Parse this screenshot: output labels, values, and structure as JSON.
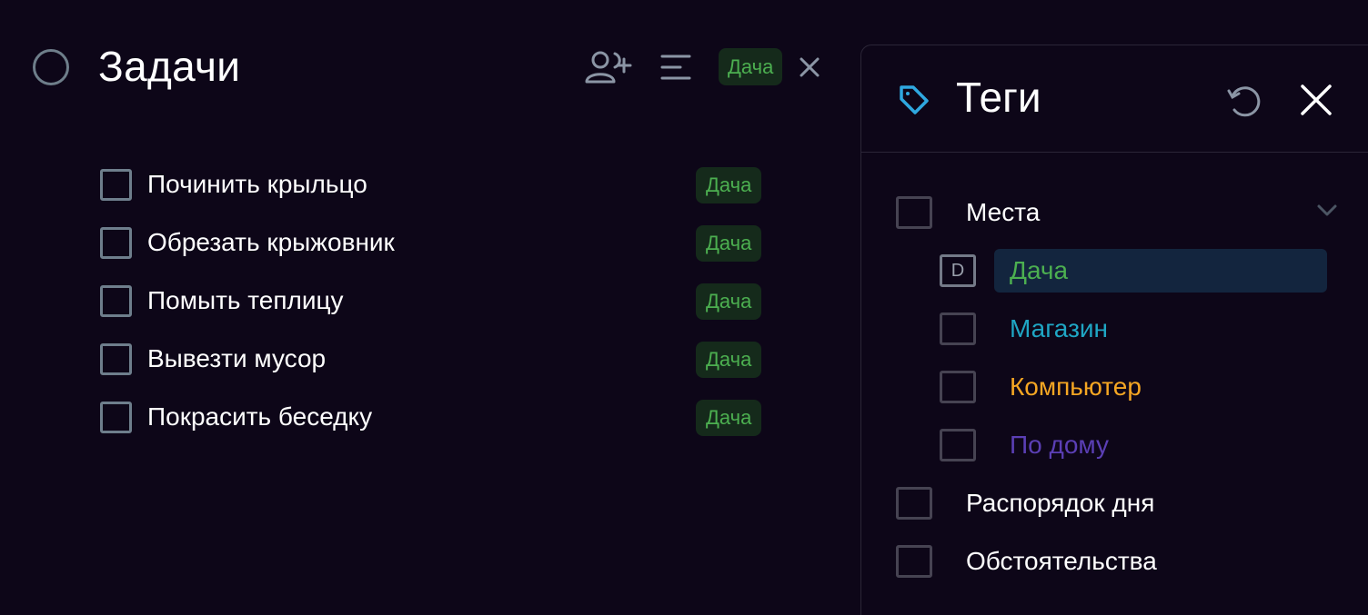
{
  "tasks": {
    "title": "Задачи",
    "filter_tag": "Дача",
    "items": [
      {
        "text": "Починить крыльцо",
        "tag": "Дача"
      },
      {
        "text": "Обрезать крыжовник",
        "tag": "Дача"
      },
      {
        "text": "Помыть теплицу",
        "tag": "Дача"
      },
      {
        "text": "Вывезти мусор",
        "tag": "Дача"
      },
      {
        "text": "Покрасить беседку",
        "tag": "Дача"
      }
    ]
  },
  "tags_panel": {
    "title": "Теги",
    "groups": [
      {
        "label": "Места",
        "expanded": true,
        "children": [
          {
            "label": "Дача",
            "color": "#4caf50",
            "selected": true,
            "check_letter": "D"
          },
          {
            "label": "Магазин",
            "color": "#1fa6c4"
          },
          {
            "label": "Компьютер",
            "color": "#f5a623"
          },
          {
            "label": "По дому",
            "color": "#5b3fb5"
          }
        ]
      },
      {
        "label": "Распорядок дня"
      },
      {
        "label": "Обстоятельства"
      }
    ]
  },
  "icons": {
    "status": "circle-icon",
    "add_person": "add-person-icon",
    "sort": "sort-lines-icon",
    "clear_filter": "close-icon",
    "tag": "tag-icon",
    "refresh": "refresh-icon",
    "close_panel": "close-icon",
    "expand": "chevron-down-icon"
  },
  "colors": {
    "background": "#0d0618",
    "tag_green": "#4caf50",
    "tag_chip_bg": "#152a1b",
    "accent_blue": "#2fa8e0",
    "selected_row_bg": "#13253e"
  }
}
